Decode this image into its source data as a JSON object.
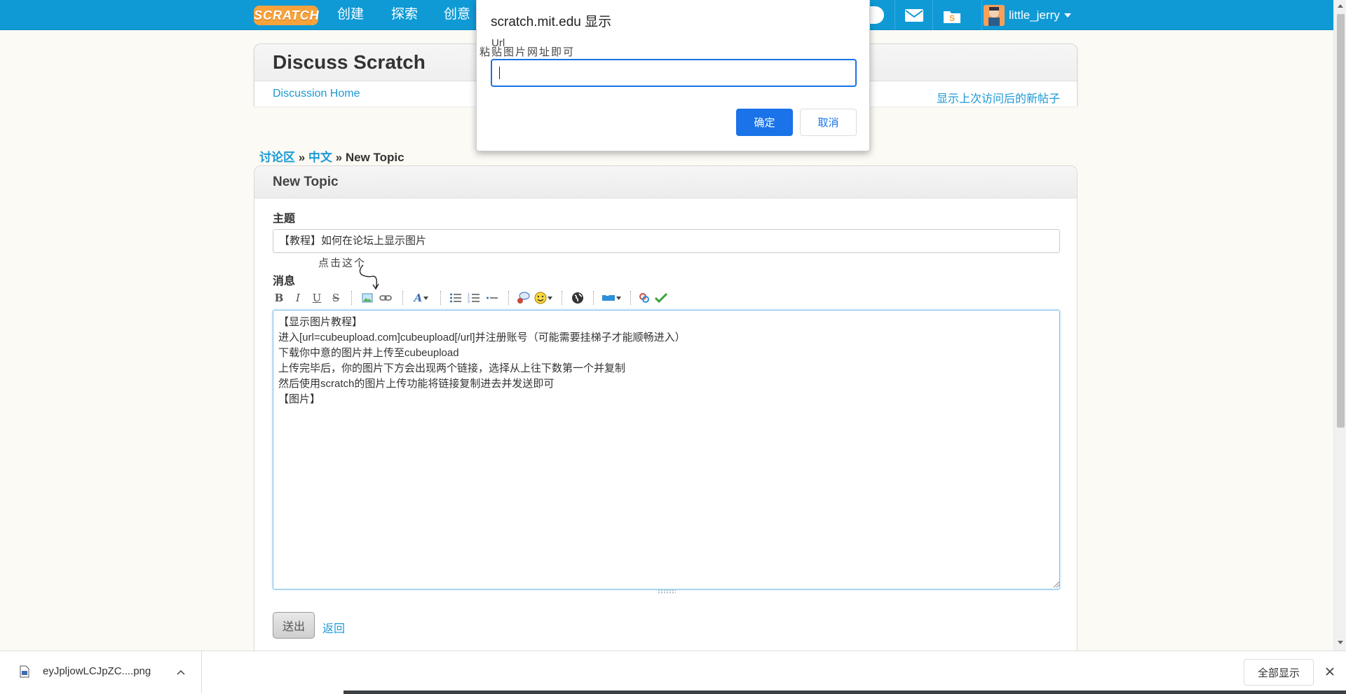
{
  "nav": {
    "logo": "SCRATCH",
    "links": [
      "创建",
      "探索",
      "创意"
    ],
    "username": "little_jerry",
    "icons": [
      "messages-icon",
      "mystuff-icon"
    ]
  },
  "discuss": {
    "title": "Discuss Scratch",
    "home_link": "Discussion Home",
    "new_posts_link": "显示上次访问后的新帖子"
  },
  "breadcrumb": {
    "root": "讨论区",
    "sep1": " » ",
    "forum": "中文",
    "sep2": " » ",
    "current": "New Topic"
  },
  "new_topic": {
    "title": "New Topic",
    "subject_label": "主题",
    "subject_value": "【教程】如何在论坛上显示图片",
    "message_label": "消息",
    "message_value": "【显示图片教程】\n进入[url=cubeupload.com]cubeupload[/url]并注册账号（可能需要挂梯子才能顺畅进入）\n下载你中意的图片并上传至cubeupload\n上传完毕后，你的图片下方会出现两个链接，选择从上往下数第一个并复制\n然后使用scratch的图片上传功能将链接复制进去并发送即可\n【图片】",
    "submit_label": "送出",
    "back_label": "返回",
    "annotation": "点击这个"
  },
  "toolbar": {
    "bold": "B",
    "italic": "I",
    "underline": "U",
    "strike": "S",
    "font": "A"
  },
  "dialog": {
    "title": "scratch.mit.edu 显示",
    "message": "Url",
    "handwritten_note": "粘贴图片网址即可",
    "input_value": "",
    "ok_label": "确定",
    "cancel_label": "取消"
  },
  "download_bar": {
    "file_name": "eyJpljowLCJpZC....png",
    "show_all_label": "全部显示"
  },
  "colors": {
    "nav_blue": "#0f9ad6",
    "link_blue": "#1b9ad6",
    "dialog_blue": "#1a73e8",
    "logo_orange": "#f7a23b",
    "page_bg": "#fcfaf4"
  }
}
